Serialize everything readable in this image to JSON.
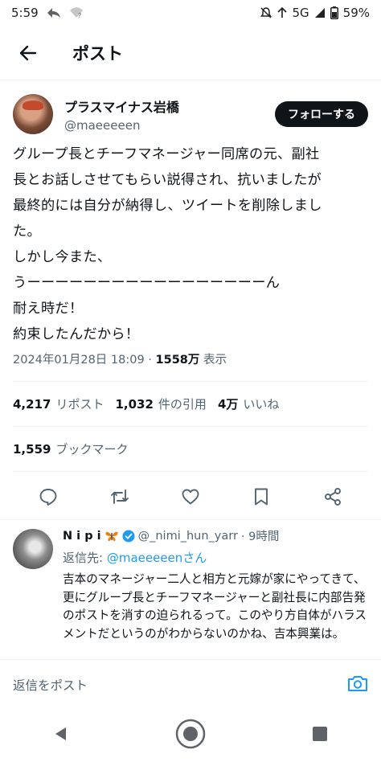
{
  "status": {
    "time": "5:59",
    "network": "5G",
    "battery": "59%"
  },
  "header": {
    "title": "ポスト"
  },
  "author": {
    "name": "プラスマイナス岩橋",
    "handle": "@maeeeeen",
    "follow_label": "フォローする"
  },
  "tweet": {
    "text": "グループ長とチーフマネージャー同席の元、副社\n長とお話しさせてもらい説得され、抗いましたが\n最終的には自分が納得し、ツイートを削除しまし\nた。\nしかし今また、\nうーーーーーーーーーーーーーーーーーん\n耐え時だ！\n約束したんだから！",
    "timestamp": "2024年01月28日 18:09",
    "separator": " · ",
    "views_count": "1558万",
    "views_label": " 表示"
  },
  "stats": {
    "reposts_count": "4,217",
    "reposts_label": "リポスト",
    "quotes_count": "1,032",
    "quotes_label": "件の引用",
    "likes_count": "4万",
    "likes_label": "いいね",
    "bookmarks_count": "1,559",
    "bookmarks_label": "ブックマーク"
  },
  "reply": {
    "name": "N i p i",
    "handle": "@_nimi_hun_yarr",
    "time": "· 9時間",
    "reply_to_prefix": "返信先: ",
    "reply_to_handle": "@maeeeeenさん",
    "text": "吉本のマネージャー二人と相方と元嫁が家にやってきて、更にグループ長とチーフマネージャーと副社長に内部告発のポストを消すの迫られるって。このやり方自体がハラスメントだというのがわからないのかね、吉本興業は。"
  },
  "compose": {
    "placeholder": "返信をポスト"
  },
  "colors": {
    "accent": "#1d9bf0",
    "text": "#0f1419",
    "secondary": "#536471"
  }
}
